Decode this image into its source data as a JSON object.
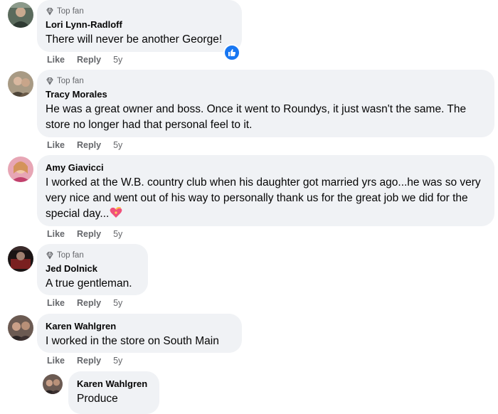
{
  "actions": {
    "like": "Like",
    "reply": "Reply"
  },
  "badge_label": "Top fan",
  "comments": [
    {
      "author": "Lori Lynn-Radloff",
      "text": "There will never be another George!",
      "time": "5y",
      "top_fan": true
    },
    {
      "author": "Tracy Morales",
      "text": "He was a great owner and boss. Once it went to Roundys, it just wasn't the same. The store no longer had that personal feel to it.",
      "time": "5y",
      "top_fan": true
    },
    {
      "author": "Amy Giavicci",
      "text": "I worked at the W.B. country club when his daughter got married yrs ago...he was so very very nice and went out of his way to personally thank us for the great job we did for the special day...",
      "time": "5y",
      "top_fan": false
    },
    {
      "author": "Jed Dolnick",
      "text": "A true gentleman.",
      "time": "5y",
      "top_fan": true
    },
    {
      "author": "Karen Wahlgren",
      "text": "I worked in the store on South Main",
      "time": "5y",
      "top_fan": false
    }
  ],
  "reply": {
    "author": "Karen Wahlgren",
    "text": "Produce"
  },
  "colors": {
    "bubble": "#f0f2f5",
    "meta": "#65676b",
    "like_blue": "#1877f2"
  }
}
